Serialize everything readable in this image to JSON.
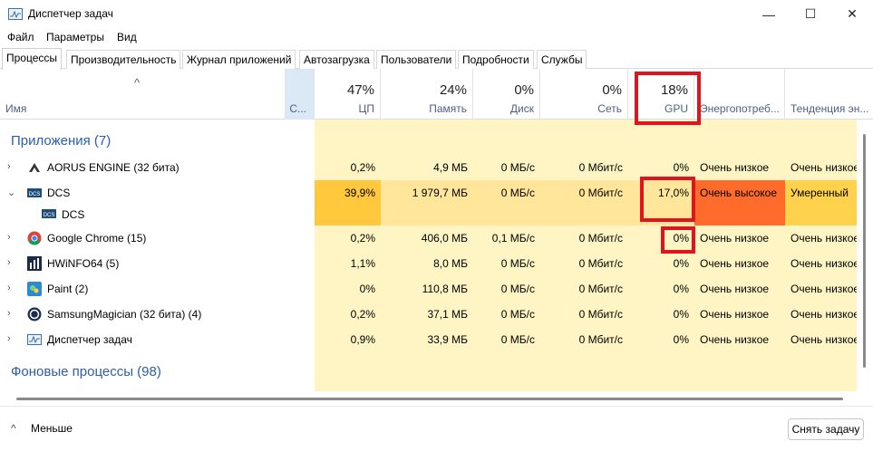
{
  "window": {
    "title": "Диспетчер задач",
    "minimize_glyph": "—",
    "maximize_glyph": "☐",
    "close_glyph": "✕"
  },
  "menu": [
    "Файл",
    "Параметры",
    "Вид"
  ],
  "tabs": [
    "Процессы",
    "Производительность",
    "Журнал приложений",
    "Автозагрузка",
    "Пользователи",
    "Подробности",
    "Службы"
  ],
  "header": {
    "sort_glyph": "^",
    "name": "Имя",
    "status": "С...",
    "cpu": {
      "pct": "47%",
      "label": "ЦП"
    },
    "memory": {
      "pct": "24%",
      "label": "Память"
    },
    "disk": {
      "pct": "0%",
      "label": "Диск"
    },
    "network": {
      "pct": "0%",
      "label": "Сеть"
    },
    "gpu": {
      "pct": "18%",
      "label": "GPU"
    },
    "power": "Энергопотреб...",
    "trend": "Тенденция эн..."
  },
  "groups": {
    "apps": "Приложения (7)",
    "background": "Фоновые процессы (98)"
  },
  "rows": [
    {
      "name": "AORUS ENGINE (32 бита)",
      "icon": "aorus-icon",
      "cpu": "0,2%",
      "mem": "4,9 МБ",
      "disk": "0 МБ/с",
      "net": "0 Мбит/с",
      "gpu": "0%",
      "power": "Очень низкое",
      "trend": "Очень низкое"
    },
    {
      "name": "DCS",
      "icon": "dcs-icon",
      "cpu": "39,9%",
      "mem": "1 979,7 МБ",
      "disk": "0 МБ/с",
      "net": "0 Мбит/с",
      "gpu": "17,0%",
      "power": "Очень высокое",
      "trend": "Умеренный"
    },
    {
      "name": "DCS",
      "icon": "dcs-icon"
    },
    {
      "name": "Google Chrome (15)",
      "icon": "chrome-icon",
      "cpu": "0,2%",
      "mem": "406,0 МБ",
      "disk": "0,1 МБ/с",
      "net": "0 Мбит/с",
      "gpu": "0%",
      "power": "Очень низкое",
      "trend": "Очень низкое"
    },
    {
      "name": "HWiNFO64 (5)",
      "icon": "hwinfo-icon",
      "cpu": "1,1%",
      "mem": "8,0 МБ",
      "disk": "0 МБ/с",
      "net": "0 Мбит/с",
      "gpu": "0%",
      "power": "Очень низкое",
      "trend": "Очень низкое"
    },
    {
      "name": "Paint (2)",
      "icon": "paint-icon",
      "cpu": "0%",
      "mem": "110,8 МБ",
      "disk": "0 МБ/с",
      "net": "0 Мбит/с",
      "gpu": "0%",
      "power": "Очень низкое",
      "trend": "Очень низкое"
    },
    {
      "name": "SamsungMagician (32 бита) (4)",
      "icon": "samsung-magician-icon",
      "cpu": "0,2%",
      "mem": "37,1 МБ",
      "disk": "0 МБ/с",
      "net": "0 Мбит/с",
      "gpu": "0%",
      "power": "Очень низкое",
      "trend": "Очень низкое"
    },
    {
      "name": "Диспетчер задач",
      "icon": "task-manager-icon",
      "cpu": "0,9%",
      "mem": "33,9 МБ",
      "disk": "0 МБ/с",
      "net": "0 Мбит/с",
      "gpu": "0%",
      "power": "Очень низкое",
      "trend": "Очень низкое"
    }
  ],
  "footer": {
    "less_glyph": "^",
    "less": "Меньше",
    "end_task": "Снять задачу"
  },
  "colors": {
    "light_yellow": "#fff4c4",
    "pale_yellow": "#fff8dc",
    "dcs_cpu": "#ffc83d",
    "dcs_row": "#ffe69a",
    "dcs_power": "#ff6b2b",
    "dcs_trend": "#ffd24d",
    "highlight": "#e0141e",
    "group_text": "#2c5ea8"
  }
}
